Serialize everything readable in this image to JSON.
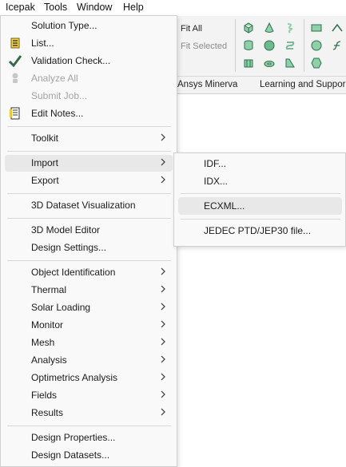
{
  "menubar": [
    "Icepak",
    "Tools",
    "Window",
    "Help"
  ],
  "ribbon": {
    "fit_all": "Fit All",
    "fit_selected": "Fit Selected",
    "tabs": [
      "Ansys Minerva",
      "Learning and Suppor"
    ]
  },
  "main_menu": {
    "solution_type": "Solution Type...",
    "list": "List...",
    "validation_check": "Validation Check...",
    "analyze_all": "Analyze All",
    "submit_job": "Submit Job...",
    "edit_notes": "Edit Notes...",
    "toolkit": "Toolkit",
    "import": "Import",
    "export": "Export",
    "dataset_visualization": "3D Dataset Visualization",
    "model_editor": "3D Model Editor",
    "design_settings": "Design Settings...",
    "object_identification": "Object Identification",
    "thermal": "Thermal",
    "solar_loading": "Solar Loading",
    "monitor": "Monitor",
    "mesh": "Mesh",
    "analysis": "Analysis",
    "optimetrics_analysis": "Optimetrics Analysis",
    "fields": "Fields",
    "results": "Results",
    "design_properties": "Design Properties...",
    "design_datasets": "Design Datasets..."
  },
  "import_submenu": {
    "idf": "IDF...",
    "idx": "IDX...",
    "ecxml": "ECXML...",
    "jedec": "JEDEC PTD/JEP30 file..."
  },
  "colors": {
    "menu_bg": "#f9f9f9",
    "highlight": "#e8e8e8",
    "ribbon_icon": "#3f8f6a",
    "disabled_text": "#a3a3a3"
  }
}
